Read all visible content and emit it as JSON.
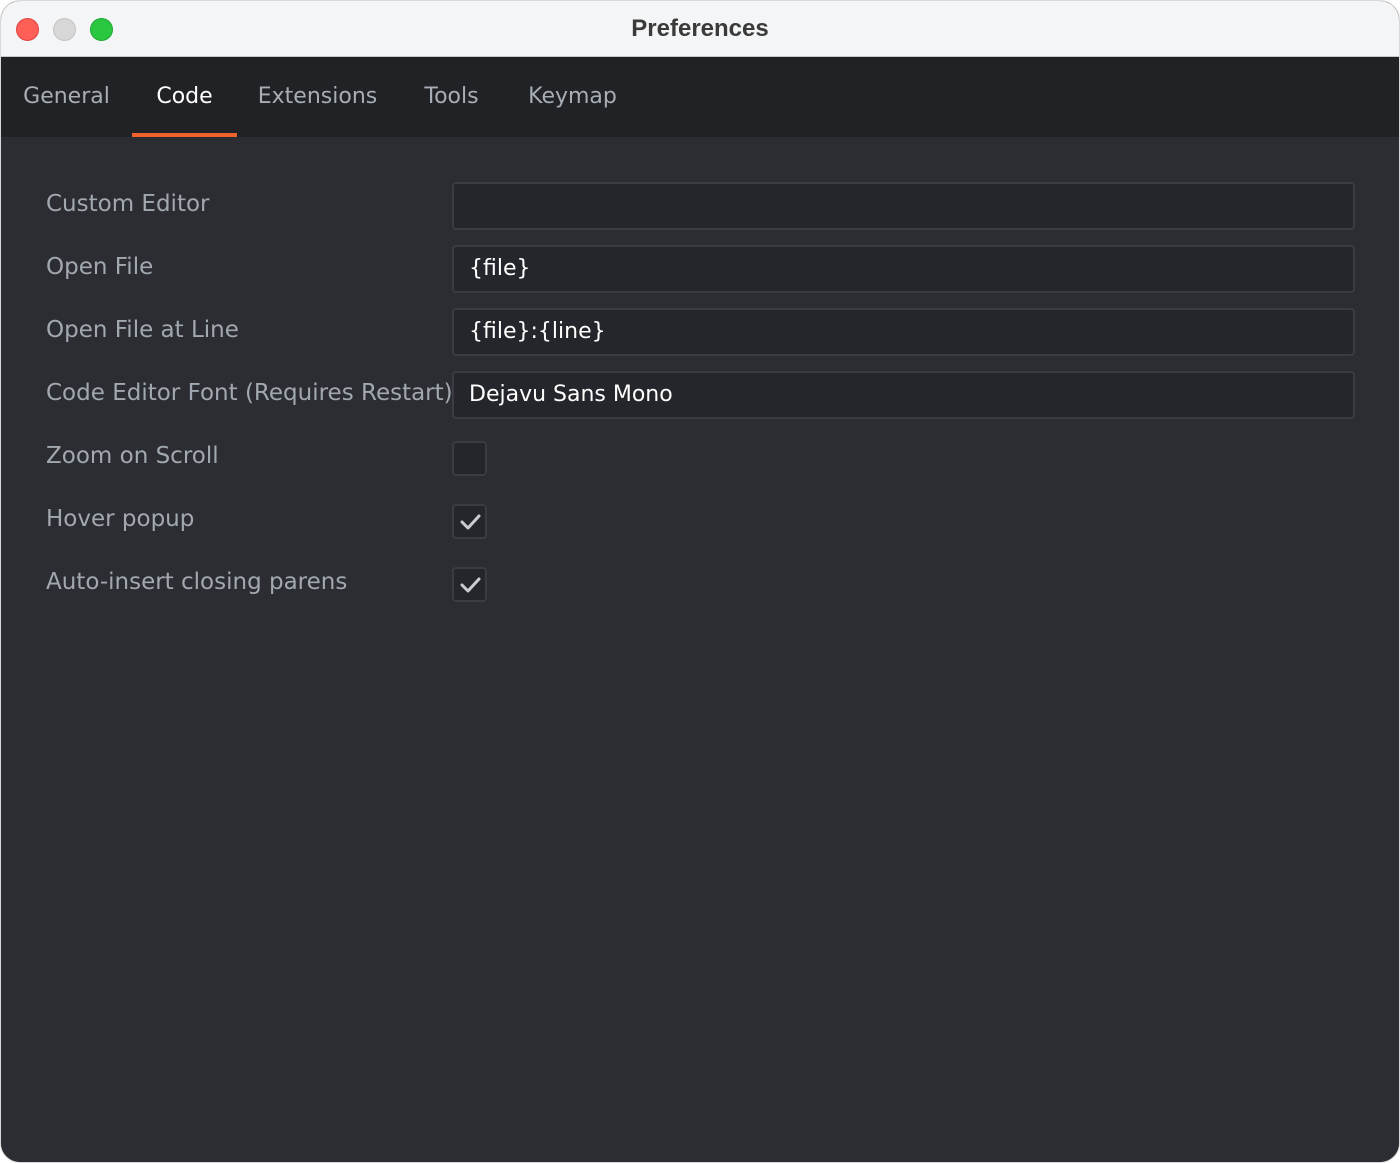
{
  "window": {
    "title": "Preferences"
  },
  "tabs": [
    {
      "label": "General"
    },
    {
      "label": "Code",
      "active": true
    },
    {
      "label": "Extensions"
    },
    {
      "label": "Tools"
    },
    {
      "label": "Keymap"
    }
  ],
  "settings": {
    "custom_editor": {
      "label": "Custom Editor",
      "value": ""
    },
    "open_file": {
      "label": "Open File",
      "value": "{file}"
    },
    "open_file_at_line": {
      "label": "Open File at Line",
      "value": "{file}:{line}"
    },
    "code_editor_font": {
      "label": "Code Editor Font (Requires Restart)",
      "value": "Dejavu Sans Mono"
    },
    "zoom_on_scroll": {
      "label": "Zoom on Scroll",
      "checked": false
    },
    "hover_popup": {
      "label": "Hover popup",
      "checked": true
    },
    "auto_insert_parens": {
      "label": "Auto-insert closing parens",
      "checked": true
    }
  },
  "colors": {
    "accent": "#f0622d",
    "background": "#2b2d33",
    "tabbar": "#212226"
  },
  "icons": {
    "checkmark": "checkmark-icon"
  }
}
